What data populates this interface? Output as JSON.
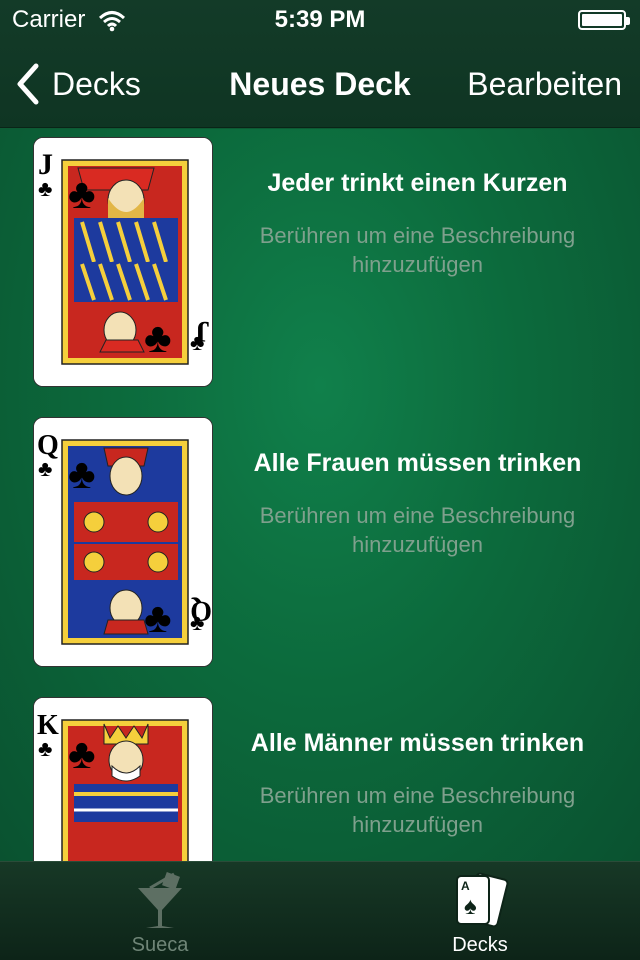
{
  "status_bar": {
    "carrier": "Carrier",
    "time": "5:39 PM"
  },
  "nav": {
    "back_label": "Decks",
    "title": "Neues Deck",
    "edit_label": "Bearbeiten"
  },
  "cards": [
    {
      "rank": "J",
      "suit": "clubs",
      "title": "Jeder trinkt einen Kurzen",
      "description": "Berühren um eine Beschreibung hinzuzufügen"
    },
    {
      "rank": "Q",
      "suit": "clubs",
      "title": "Alle Frauen müssen trinken",
      "description": "Berühren um eine Beschreibung hinzuzufügen"
    },
    {
      "rank": "K",
      "suit": "clubs",
      "title": "Alle Männer müssen trinken",
      "description": "Berühren um eine Beschreibung hinzuzufügen"
    }
  ],
  "tabs": [
    {
      "label": "Sueca",
      "icon": "cocktail-glass-icon",
      "selected": false
    },
    {
      "label": "Decks",
      "icon": "playing-cards-icon",
      "selected": true
    }
  ],
  "colors": {
    "nav_background": "#133b28",
    "table_green": "#0c6a3c",
    "description_text": "#7fa08d",
    "tab_inactive": "#6f8577"
  }
}
